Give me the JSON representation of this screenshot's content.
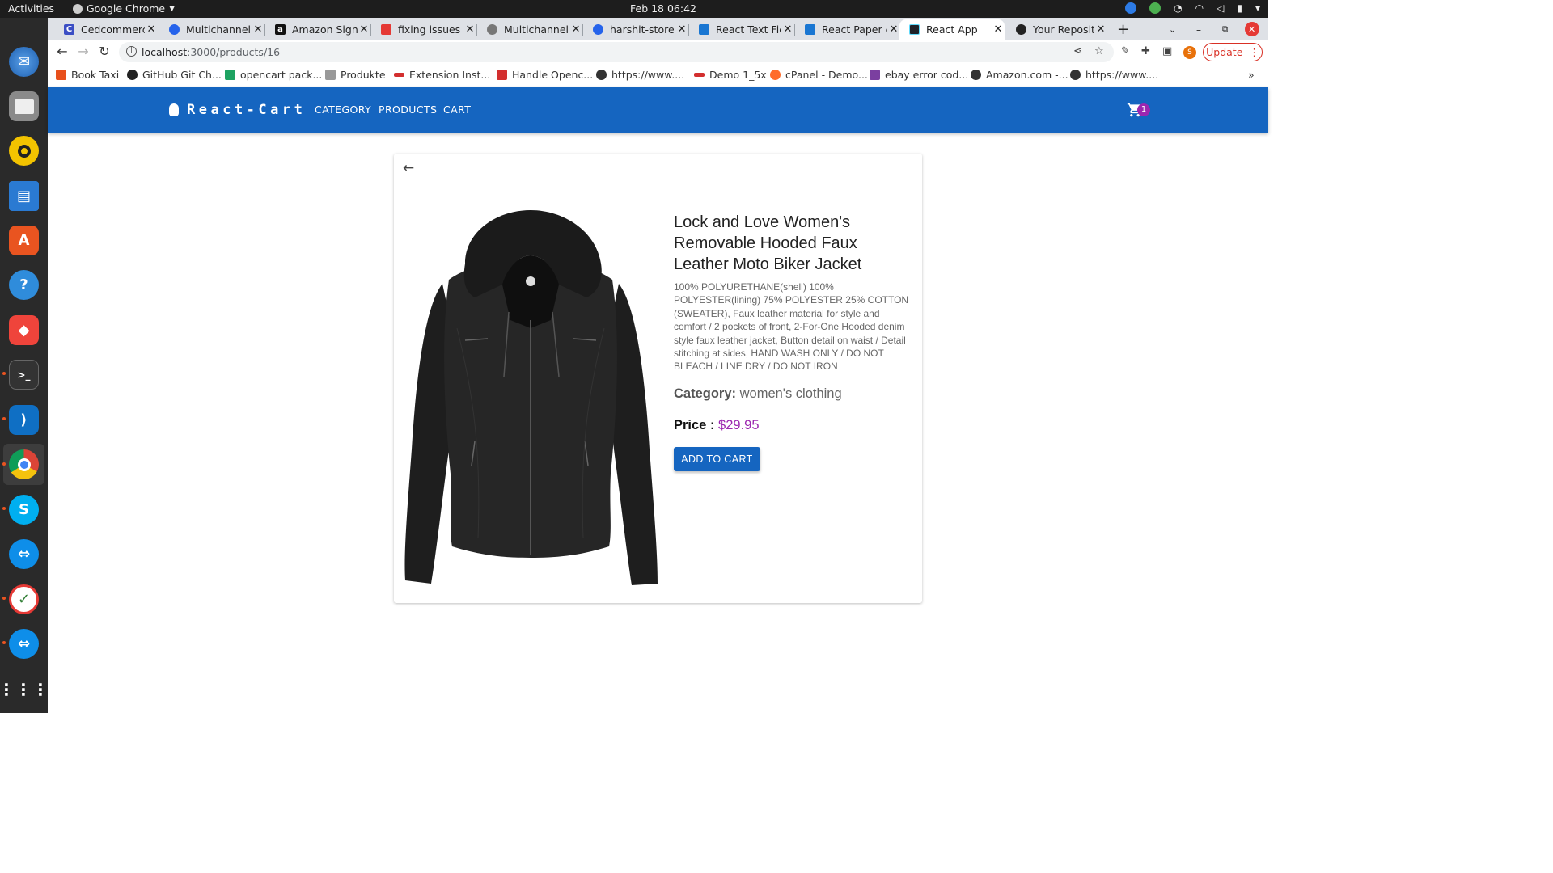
{
  "os": {
    "activities": "Activities",
    "app_name": "Google Chrome",
    "clock": "Feb 18  06:42"
  },
  "browser": {
    "tabs": [
      {
        "label": "Cedcommerce",
        "favicon_color": "#3b4ec4",
        "favicon_char": "C"
      },
      {
        "label": "Multichannel",
        "favicon_color": "#2563eb",
        "favicon_char": ""
      },
      {
        "label": "Amazon Sign",
        "favicon_color": "#111111",
        "favicon_char": "a"
      },
      {
        "label": "fixing issues i",
        "favicon_color": "#e53935",
        "favicon_char": ""
      },
      {
        "label": "Multichannel",
        "favicon_color": "#777777",
        "favicon_char": ""
      },
      {
        "label": "harshit-store",
        "favicon_color": "#2563eb",
        "favicon_char": ""
      },
      {
        "label": "React Text Fie",
        "favicon_color": "#1976d2",
        "favicon_char": ""
      },
      {
        "label": "React Paper c",
        "favicon_color": "#1976d2",
        "favicon_char": ""
      },
      {
        "label": "React App",
        "favicon_color": "#20232a",
        "favicon_char": ""
      },
      {
        "label": "Your Reposito",
        "favicon_color": "#222222",
        "favicon_char": ""
      }
    ],
    "url_host": "localhost",
    "url_path": ":3000/products/16",
    "update_label": "Update",
    "profile_initial": "S",
    "bookmarks": [
      {
        "label": "Book Taxi",
        "color": "#e8501c"
      },
      {
        "label": "GitHub Git Ch...",
        "color": "#222222"
      },
      {
        "label": "opencart pack...",
        "color": "#1ea362"
      },
      {
        "label": "Produkte",
        "color": "#999999"
      },
      {
        "label": "Extension Inst...",
        "color": "#d32f2f"
      },
      {
        "label": "Handle Openc...",
        "color": "#d32f2f"
      },
      {
        "label": "https://www....",
        "color": "#333333"
      },
      {
        "label": "Demo 1_5x",
        "color": "#d32f2f"
      },
      {
        "label": "cPanel - Demo...",
        "color": "#ff6c2c"
      },
      {
        "label": "ebay error cod...",
        "color": "#7b3fa0"
      },
      {
        "label": "Amazon.com -...",
        "color": "#333333"
      },
      {
        "label": "https://www....",
        "color": "#333333"
      }
    ]
  },
  "app": {
    "brand": "React-Cart",
    "nav": [
      "CATEGORY",
      "PRODUCTS",
      "CART"
    ],
    "cart_count": "1",
    "accent": "#1565c0",
    "price_color": "#9c27b0"
  },
  "product": {
    "title": "Lock and Love Women's Removable Hooded Faux Leather Moto Biker Jacket",
    "description": "100% POLYURETHANE(shell) 100% POLYESTER(lining) 75% POLYESTER 25% COTTON (SWEATER), Faux leather material for style and comfort / 2 pockets of front, 2-For-One Hooded denim style faux leather jacket, Button detail on waist / Detail stitching at sides, HAND WASH ONLY / DO NOT BLEACH / LINE DRY / DO NOT IRON",
    "category_label": "Category:",
    "category": "women's clothing",
    "price_label": "Price :",
    "price": "$29.95",
    "add_to_cart": "ADD TO CART"
  }
}
